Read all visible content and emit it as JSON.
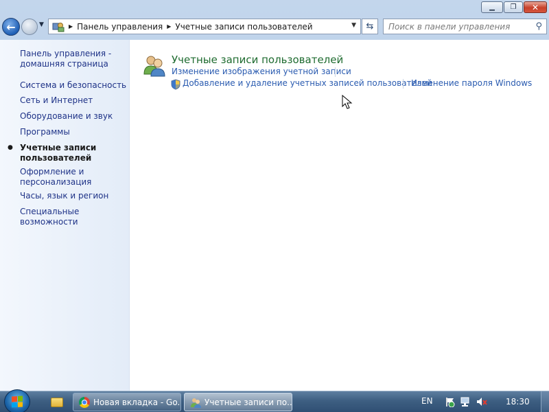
{
  "window": {
    "caption": {
      "minimize": "0",
      "maximize": "1",
      "close": "r"
    }
  },
  "navbar": {
    "breadcrumb": [
      "Панель управления",
      "Учетные записи пользователей"
    ],
    "search": {
      "placeholder": "Поиск в панели управления",
      "value": ""
    }
  },
  "sidebar": {
    "items": [
      {
        "label": "Панель управления - домашняя страница",
        "active": false
      },
      {
        "label": "Система и безопасность",
        "active": false
      },
      {
        "label": "Сеть и Интернет",
        "active": false
      },
      {
        "label": "Оборудование и звук",
        "active": false
      },
      {
        "label": "Программы",
        "active": false
      },
      {
        "label": "Учетные записи пользователей",
        "active": true
      },
      {
        "label": "Оформление и персонализация",
        "active": false
      },
      {
        "label": "Часы, язык и регион",
        "active": false
      },
      {
        "label": "Специальные возможности",
        "active": false
      }
    ]
  },
  "main": {
    "category": {
      "title": "Учетные записи пользователей",
      "icon": "users-icon",
      "tasks": [
        "Изменение изображения учетной записи",
        "Добавление и удаление учетных записей пользователей",
        "Изменение пароля Windows"
      ]
    }
  },
  "taskbar": {
    "buttons": [
      {
        "label": "Новая вкладка - Go...",
        "icon": "chrome-icon"
      },
      {
        "label": "Учетные записи по...",
        "icon": "control-panel-icon",
        "active": true
      }
    ],
    "language": "EN",
    "clock": "18:30"
  },
  "colors": {
    "link": "#1e3287",
    "task_link": "#2a5bb0",
    "category_title": "#1e6b2f",
    "taskbar": "#3e5f82"
  }
}
